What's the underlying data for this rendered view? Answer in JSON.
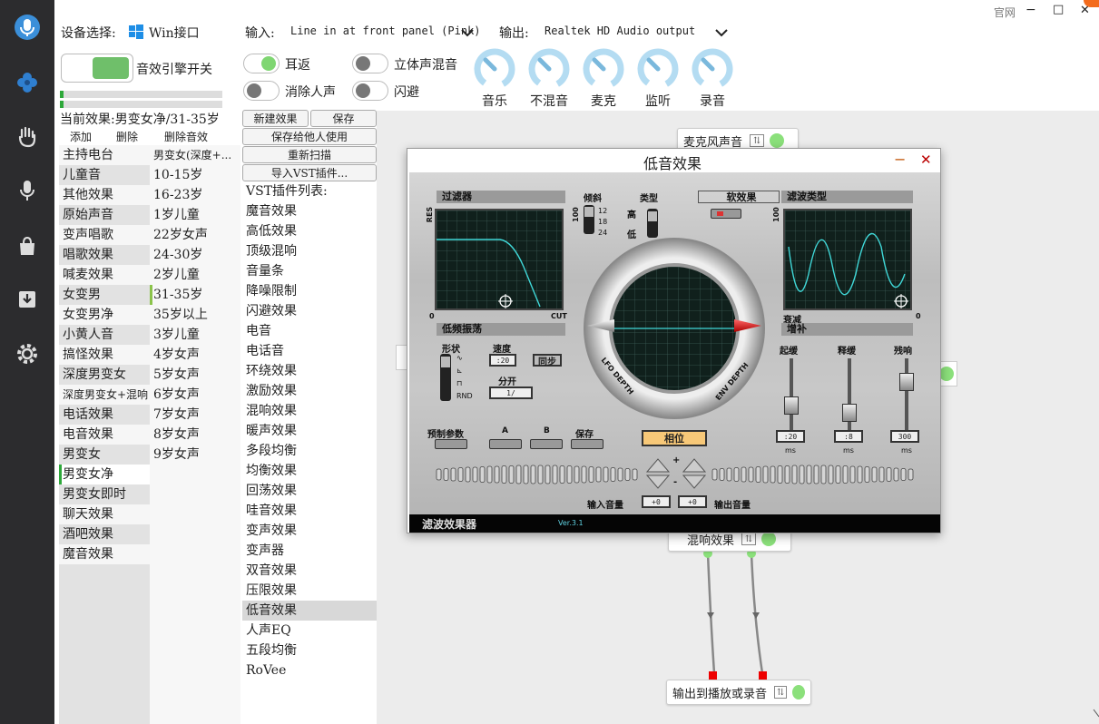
{
  "window": {
    "official_link": "官网",
    "minimize": "−",
    "maximize": "□",
    "close": "✕"
  },
  "top": {
    "device_label": "设备选择:",
    "device_value": "Win接口",
    "input_label": "输入:",
    "input_value": "Line in at front panel (Pink)",
    "output_label": "输出:",
    "output_value": "Realtek HD Audio output"
  },
  "engine": {
    "label": "音效引擎开关"
  },
  "toggles": [
    {
      "label": "耳返",
      "on": true
    },
    {
      "label": "立体声混音",
      "on": false
    },
    {
      "label": "消除人声",
      "on": false
    },
    {
      "label": "闪避",
      "on": false
    }
  ],
  "dials": [
    {
      "label": "音乐"
    },
    {
      "label": "不混音"
    },
    {
      "label": "麦克"
    },
    {
      "label": "监听"
    },
    {
      "label": "录音"
    }
  ],
  "current_effect": "当前效果:男变女净/31-35岁",
  "effect_actions": {
    "add": "添加",
    "delete": "删除",
    "delete_sound": "删除音效"
  },
  "categories": [
    "主持电台",
    "儿童音",
    "其他效果",
    "原始声音",
    "变声唱歌",
    "唱歌效果",
    "喊麦效果",
    "女变男",
    "女变男净",
    "小黄人音",
    "搞怪效果",
    "深度男变女",
    "深度男变女+混响",
    "电话效果",
    "电音效果",
    "男变女",
    "男变女净",
    "男变女即时",
    "聊天效果",
    "酒吧效果",
    "魔音效果"
  ],
  "presets": [
    "男变女(深度+...",
    "10-15岁",
    "16-23岁",
    "1岁儿童",
    "22岁女声",
    "24-30岁",
    "2岁儿童",
    "31-35岁",
    "35岁以上",
    "3岁儿童",
    "4岁女声",
    "5岁女声",
    "6岁女声",
    "7岁女声",
    "8岁女声",
    "9岁女声"
  ],
  "plugin_buttons": {
    "new_effect": "新建效果",
    "save": "保存",
    "save_for_others": "保存给他人使用",
    "rescan": "重新扫描",
    "import_vst": "导入VST插件..."
  },
  "vst_list_title": "VST插件列表:",
  "vst_list": [
    "魔音效果",
    "高低效果",
    "顶级混响",
    "音量条",
    "降噪限制",
    "闪避效果",
    "电音",
    "电话音",
    "环绕效果",
    "激励效果",
    "混响效果",
    "暖声效果",
    "多段均衡",
    "均衡效果",
    "回荡效果",
    "哇音效果",
    "变声效果",
    "变声器",
    "双音效果",
    "压限效果",
    "低音效果",
    "人声EQ",
    "五段均衡",
    "RoVee"
  ],
  "vst_selected": "低音效果",
  "nodes": {
    "mic": "麦克风声音",
    "reverb": "混响效果",
    "output": "输出到播放或录音"
  },
  "dialog": {
    "title": "低音效果",
    "minimize": "−",
    "close": "✕",
    "filter": "过滤器",
    "slope": "倾斜",
    "type": "类型",
    "soft_effect": "软效果",
    "filter_type": "滤波类型",
    "res": "RES",
    "res_max": "100",
    "res_zero": "0",
    "cut": "CUT",
    "slopes": [
      "12",
      "18",
      "24"
    ],
    "type_high": "高",
    "type_low": "低",
    "ft_max": "100",
    "ft_zero": "0",
    "decay": "衰减",
    "gain": "增补",
    "lfo": "低频振荡",
    "shape": "形状",
    "shapes": [
      "∿",
      "⊾",
      "⊓",
      "RND"
    ],
    "speed": "速度",
    "speed_val": ":20",
    "sync": "同步",
    "split": "分开",
    "split_val": "1/",
    "lfo_depth": "LFO DEPTH",
    "env_depth": "ENV DEPTH",
    "attack": "起缓",
    "release": "释缓",
    "residual": "残响",
    "attack_val": ":20",
    "release_val": ":8",
    "residual_val": "300",
    "ms": "ms",
    "presets": "预制参数",
    "preset_a": "A",
    "preset_b": "B",
    "preset_save": "保存",
    "phase": "相位",
    "plus": "+",
    "minus": "-",
    "input_volume": "输入音量",
    "input_val": "+0",
    "output_val": "+0",
    "output_volume": "输出音量",
    "brand": "滤波效果器",
    "version": "Ver.3.1"
  }
}
